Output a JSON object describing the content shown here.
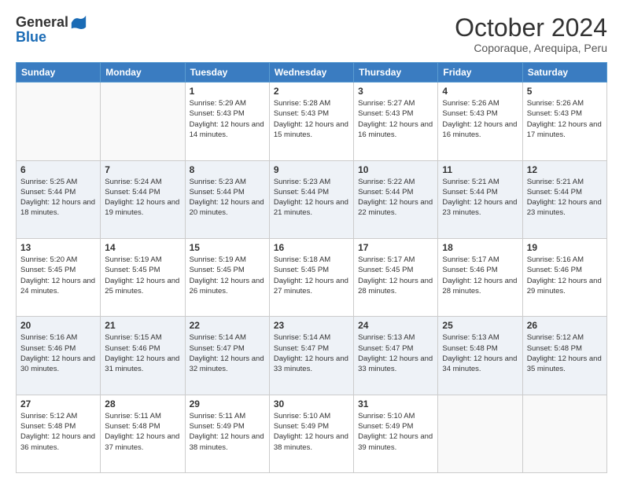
{
  "logo": {
    "general": "General",
    "blue": "Blue"
  },
  "header": {
    "month": "October 2024",
    "location": "Coporaque, Arequipa, Peru"
  },
  "weekdays": [
    "Sunday",
    "Monday",
    "Tuesday",
    "Wednesday",
    "Thursday",
    "Friday",
    "Saturday"
  ],
  "weeks": [
    [
      {
        "day": "",
        "info": ""
      },
      {
        "day": "",
        "info": ""
      },
      {
        "day": "1",
        "sunrise": "Sunrise: 5:29 AM",
        "sunset": "Sunset: 5:43 PM",
        "daylight": "Daylight: 12 hours and 14 minutes."
      },
      {
        "day": "2",
        "sunrise": "Sunrise: 5:28 AM",
        "sunset": "Sunset: 5:43 PM",
        "daylight": "Daylight: 12 hours and 15 minutes."
      },
      {
        "day": "3",
        "sunrise": "Sunrise: 5:27 AM",
        "sunset": "Sunset: 5:43 PM",
        "daylight": "Daylight: 12 hours and 16 minutes."
      },
      {
        "day": "4",
        "sunrise": "Sunrise: 5:26 AM",
        "sunset": "Sunset: 5:43 PM",
        "daylight": "Daylight: 12 hours and 16 minutes."
      },
      {
        "day": "5",
        "sunrise": "Sunrise: 5:26 AM",
        "sunset": "Sunset: 5:43 PM",
        "daylight": "Daylight: 12 hours and 17 minutes."
      }
    ],
    [
      {
        "day": "6",
        "sunrise": "Sunrise: 5:25 AM",
        "sunset": "Sunset: 5:44 PM",
        "daylight": "Daylight: 12 hours and 18 minutes."
      },
      {
        "day": "7",
        "sunrise": "Sunrise: 5:24 AM",
        "sunset": "Sunset: 5:44 PM",
        "daylight": "Daylight: 12 hours and 19 minutes."
      },
      {
        "day": "8",
        "sunrise": "Sunrise: 5:23 AM",
        "sunset": "Sunset: 5:44 PM",
        "daylight": "Daylight: 12 hours and 20 minutes."
      },
      {
        "day": "9",
        "sunrise": "Sunrise: 5:23 AM",
        "sunset": "Sunset: 5:44 PM",
        "daylight": "Daylight: 12 hours and 21 minutes."
      },
      {
        "day": "10",
        "sunrise": "Sunrise: 5:22 AM",
        "sunset": "Sunset: 5:44 PM",
        "daylight": "Daylight: 12 hours and 22 minutes."
      },
      {
        "day": "11",
        "sunrise": "Sunrise: 5:21 AM",
        "sunset": "Sunset: 5:44 PM",
        "daylight": "Daylight: 12 hours and 23 minutes."
      },
      {
        "day": "12",
        "sunrise": "Sunrise: 5:21 AM",
        "sunset": "Sunset: 5:44 PM",
        "daylight": "Daylight: 12 hours and 23 minutes."
      }
    ],
    [
      {
        "day": "13",
        "sunrise": "Sunrise: 5:20 AM",
        "sunset": "Sunset: 5:45 PM",
        "daylight": "Daylight: 12 hours and 24 minutes."
      },
      {
        "day": "14",
        "sunrise": "Sunrise: 5:19 AM",
        "sunset": "Sunset: 5:45 PM",
        "daylight": "Daylight: 12 hours and 25 minutes."
      },
      {
        "day": "15",
        "sunrise": "Sunrise: 5:19 AM",
        "sunset": "Sunset: 5:45 PM",
        "daylight": "Daylight: 12 hours and 26 minutes."
      },
      {
        "day": "16",
        "sunrise": "Sunrise: 5:18 AM",
        "sunset": "Sunset: 5:45 PM",
        "daylight": "Daylight: 12 hours and 27 minutes."
      },
      {
        "day": "17",
        "sunrise": "Sunrise: 5:17 AM",
        "sunset": "Sunset: 5:45 PM",
        "daylight": "Daylight: 12 hours and 28 minutes."
      },
      {
        "day": "18",
        "sunrise": "Sunrise: 5:17 AM",
        "sunset": "Sunset: 5:46 PM",
        "daylight": "Daylight: 12 hours and 28 minutes."
      },
      {
        "day": "19",
        "sunrise": "Sunrise: 5:16 AM",
        "sunset": "Sunset: 5:46 PM",
        "daylight": "Daylight: 12 hours and 29 minutes."
      }
    ],
    [
      {
        "day": "20",
        "sunrise": "Sunrise: 5:16 AM",
        "sunset": "Sunset: 5:46 PM",
        "daylight": "Daylight: 12 hours and 30 minutes."
      },
      {
        "day": "21",
        "sunrise": "Sunrise: 5:15 AM",
        "sunset": "Sunset: 5:46 PM",
        "daylight": "Daylight: 12 hours and 31 minutes."
      },
      {
        "day": "22",
        "sunrise": "Sunrise: 5:14 AM",
        "sunset": "Sunset: 5:47 PM",
        "daylight": "Daylight: 12 hours and 32 minutes."
      },
      {
        "day": "23",
        "sunrise": "Sunrise: 5:14 AM",
        "sunset": "Sunset: 5:47 PM",
        "daylight": "Daylight: 12 hours and 33 minutes."
      },
      {
        "day": "24",
        "sunrise": "Sunrise: 5:13 AM",
        "sunset": "Sunset: 5:47 PM",
        "daylight": "Daylight: 12 hours and 33 minutes."
      },
      {
        "day": "25",
        "sunrise": "Sunrise: 5:13 AM",
        "sunset": "Sunset: 5:48 PM",
        "daylight": "Daylight: 12 hours and 34 minutes."
      },
      {
        "day": "26",
        "sunrise": "Sunrise: 5:12 AM",
        "sunset": "Sunset: 5:48 PM",
        "daylight": "Daylight: 12 hours and 35 minutes."
      }
    ],
    [
      {
        "day": "27",
        "sunrise": "Sunrise: 5:12 AM",
        "sunset": "Sunset: 5:48 PM",
        "daylight": "Daylight: 12 hours and 36 minutes."
      },
      {
        "day": "28",
        "sunrise": "Sunrise: 5:11 AM",
        "sunset": "Sunset: 5:48 PM",
        "daylight": "Daylight: 12 hours and 37 minutes."
      },
      {
        "day": "29",
        "sunrise": "Sunrise: 5:11 AM",
        "sunset": "Sunset: 5:49 PM",
        "daylight": "Daylight: 12 hours and 38 minutes."
      },
      {
        "day": "30",
        "sunrise": "Sunrise: 5:10 AM",
        "sunset": "Sunset: 5:49 PM",
        "daylight": "Daylight: 12 hours and 38 minutes."
      },
      {
        "day": "31",
        "sunrise": "Sunrise: 5:10 AM",
        "sunset": "Sunset: 5:49 PM",
        "daylight": "Daylight: 12 hours and 39 minutes."
      },
      {
        "day": "",
        "info": ""
      },
      {
        "day": "",
        "info": ""
      }
    ]
  ]
}
